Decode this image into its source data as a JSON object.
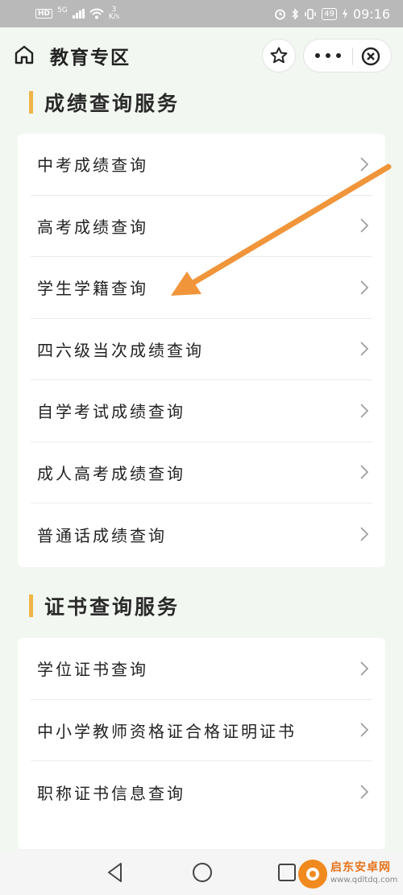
{
  "status_bar": {
    "hd": "HD",
    "network": "5G",
    "speed_value": "3",
    "speed_unit": "K/s",
    "battery": "49",
    "time": "09:16"
  },
  "header": {
    "title": "教育专区"
  },
  "sections": [
    {
      "title": "成绩查询服务",
      "items": [
        {
          "label": "中考成绩查询"
        },
        {
          "label": "高考成绩查询"
        },
        {
          "label": "学生学籍查询"
        },
        {
          "label": "四六级当次成绩查询"
        },
        {
          "label": "自学考试成绩查询"
        },
        {
          "label": "成人高考成绩查询"
        },
        {
          "label": "普通话成绩查询"
        }
      ]
    },
    {
      "title": "证书查询服务",
      "items": [
        {
          "label": "学位证书查询"
        },
        {
          "label": "中小学教师资格证合格证明证书"
        },
        {
          "label": "职称证书信息查询"
        }
      ]
    }
  ],
  "watermark": {
    "name": "启东安卓网",
    "url": "www.qdltdq.com"
  },
  "colors": {
    "accent_bar": "#f0b54a",
    "annotation_arrow": "#f0953a",
    "page_bg": "#f2f7f1"
  }
}
